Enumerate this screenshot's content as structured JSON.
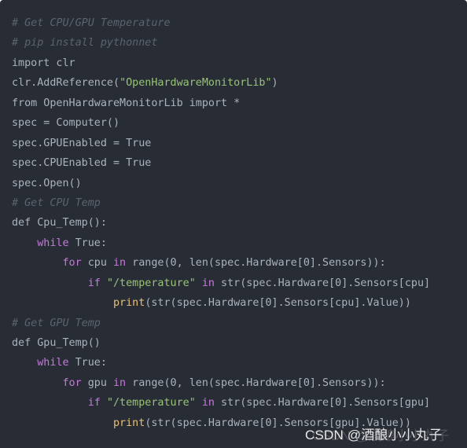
{
  "colors": {
    "background": "#282c34",
    "plain": "#abb2bf",
    "comment": "#5c6370",
    "string": "#98c379",
    "keyword": "#c678dd",
    "builtin": "#e5c07b"
  },
  "code": {
    "language": "python",
    "lines": [
      [
        {
          "t": "comment",
          "v": "# Get CPU/GPU Temperature"
        }
      ],
      [
        {
          "t": "comment",
          "v": "# pip install pythonnet"
        }
      ],
      [
        {
          "t": "plain",
          "v": "import clr"
        }
      ],
      [
        {
          "t": "plain",
          "v": "clr.AddReference("
        },
        {
          "t": "string",
          "v": "\"OpenHardwareMonitorLib\""
        },
        {
          "t": "plain",
          "v": ")"
        }
      ],
      [
        {
          "t": "plain",
          "v": "from OpenHardwareMonitorLib import *"
        }
      ],
      [
        {
          "t": "plain",
          "v": "spec = Computer()"
        }
      ],
      [
        {
          "t": "plain",
          "v": "spec.GPUEnabled = True"
        }
      ],
      [
        {
          "t": "plain",
          "v": "spec.CPUEnabled = True"
        }
      ],
      [
        {
          "t": "plain",
          "v": "spec.Open()"
        }
      ],
      [
        {
          "t": "comment",
          "v": "# Get CPU Temp"
        }
      ],
      [
        {
          "t": "plain",
          "v": "def Cpu_Temp():"
        }
      ],
      [
        {
          "t": "plain",
          "v": "    "
        },
        {
          "t": "keyword",
          "v": "while"
        },
        {
          "t": "plain",
          "v": " True:"
        }
      ],
      [
        {
          "t": "plain",
          "v": "        "
        },
        {
          "t": "keyword",
          "v": "for"
        },
        {
          "t": "plain",
          "v": " cpu "
        },
        {
          "t": "keyword",
          "v": "in"
        },
        {
          "t": "plain",
          "v": " range(0, len(spec.Hardware[0].Sensors)):"
        }
      ],
      [
        {
          "t": "plain",
          "v": "            "
        },
        {
          "t": "keyword",
          "v": "if"
        },
        {
          "t": "plain",
          "v": " "
        },
        {
          "t": "string",
          "v": "\"/temperature\""
        },
        {
          "t": "plain",
          "v": " "
        },
        {
          "t": "keyword",
          "v": "in"
        },
        {
          "t": "plain",
          "v": " str(spec.Hardware[0].Sensors[cpu]"
        }
      ],
      [
        {
          "t": "plain",
          "v": "                "
        },
        {
          "t": "builtin",
          "v": "print"
        },
        {
          "t": "plain",
          "v": "(str(spec.Hardware[0].Sensors[cpu].Value))"
        }
      ],
      [
        {
          "t": "comment",
          "v": "# Get GPU Temp"
        }
      ],
      [
        {
          "t": "plain",
          "v": "def Gpu_Temp()"
        }
      ],
      [
        {
          "t": "plain",
          "v": "    "
        },
        {
          "t": "keyword",
          "v": "while"
        },
        {
          "t": "plain",
          "v": " True:"
        }
      ],
      [
        {
          "t": "plain",
          "v": "        "
        },
        {
          "t": "keyword",
          "v": "for"
        },
        {
          "t": "plain",
          "v": " gpu "
        },
        {
          "t": "keyword",
          "v": "in"
        },
        {
          "t": "plain",
          "v": " range(0, len(spec.Hardware[0].Sensors)):"
        }
      ],
      [
        {
          "t": "plain",
          "v": "            "
        },
        {
          "t": "keyword",
          "v": "if"
        },
        {
          "t": "plain",
          "v": " "
        },
        {
          "t": "string",
          "v": "\"/temperature\""
        },
        {
          "t": "plain",
          "v": " "
        },
        {
          "t": "keyword",
          "v": "in"
        },
        {
          "t": "plain",
          "v": " str(spec.Hardware[0].Sensors[gpu]"
        }
      ],
      [
        {
          "t": "plain",
          "v": "                "
        },
        {
          "t": "builtin",
          "v": "print"
        },
        {
          "t": "plain",
          "v": "(str(spec.Hardware[0].Sensors[gpu].Value))"
        }
      ]
    ]
  },
  "watermark": {
    "text": "CSDN @酒酿小小丸子"
  }
}
